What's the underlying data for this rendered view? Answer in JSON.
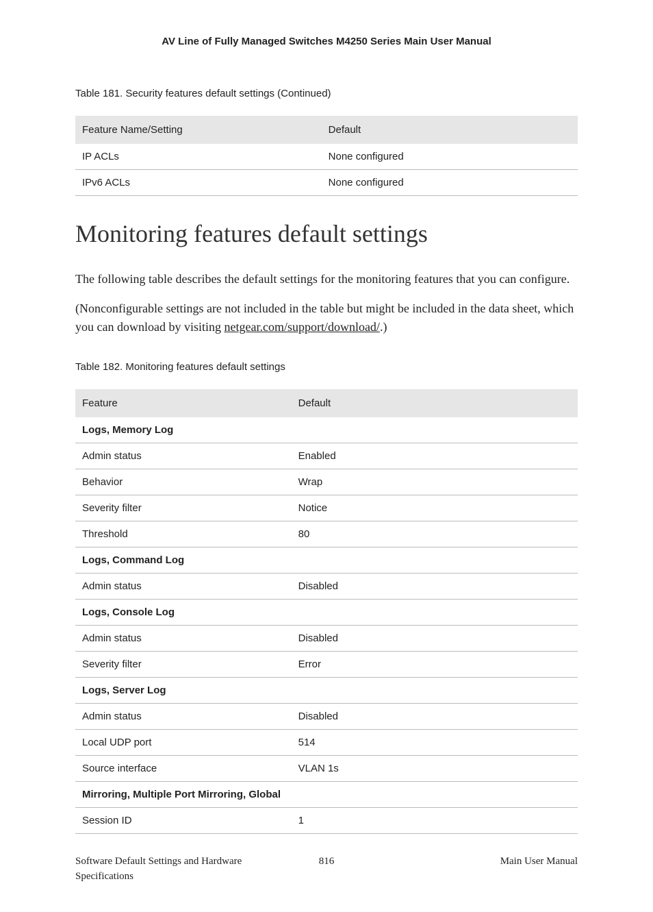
{
  "header": {
    "title": "AV Line of Fully Managed Switches M4250 Series Main User Manual"
  },
  "table181": {
    "caption": "Table 181. Security features default settings (Continued)",
    "columns": {
      "c0": "Feature Name/Setting",
      "c1": "Default"
    },
    "rows": [
      {
        "c0": "IP ACLs",
        "c1": "None configured"
      },
      {
        "c0": "IPv6 ACLs",
        "c1": "None configured"
      }
    ]
  },
  "section": {
    "heading": "Monitoring features default settings",
    "para1": "The following table describes the default settings for the monitoring features that you can configure.",
    "para2_a": "(Nonconfigurable settings are not included in the table but might be included in the data sheet, which you can download by visiting ",
    "para2_link": "netgear.com/support/download/",
    "para2_b": ".)"
  },
  "table182": {
    "caption": "Table 182. Monitoring features default settings",
    "columns": {
      "c0": "Feature",
      "c1": "Default"
    },
    "rows": [
      {
        "section": true,
        "c0": "Logs, Memory Log",
        "c1": ""
      },
      {
        "c0": "Admin status",
        "c1": "Enabled"
      },
      {
        "c0": "Behavior",
        "c1": "Wrap"
      },
      {
        "c0": "Severity filter",
        "c1": "Notice"
      },
      {
        "c0": "Threshold",
        "c1": "80"
      },
      {
        "section": true,
        "c0": "Logs, Command Log",
        "c1": ""
      },
      {
        "c0": "Admin status",
        "c1": "Disabled"
      },
      {
        "section": true,
        "c0": "Logs, Console Log",
        "c1": ""
      },
      {
        "c0": "Admin status",
        "c1": "Disabled"
      },
      {
        "c0": "Severity filter",
        "c1": "Error"
      },
      {
        "section": true,
        "c0": "Logs, Server Log",
        "c1": ""
      },
      {
        "c0": "Admin status",
        "c1": "Disabled"
      },
      {
        "c0": "Local UDP port",
        "c1": "514"
      },
      {
        "c0": "Source interface",
        "c1": "VLAN 1s"
      },
      {
        "section": true,
        "c0": "Mirroring, Multiple Port Mirroring, Global",
        "c1": ""
      },
      {
        "c0": "Session ID",
        "c1": "1"
      }
    ]
  },
  "footer": {
    "left": "Software Default Settings and Hardware Specifications",
    "center": "816",
    "right": "Main User Manual"
  }
}
